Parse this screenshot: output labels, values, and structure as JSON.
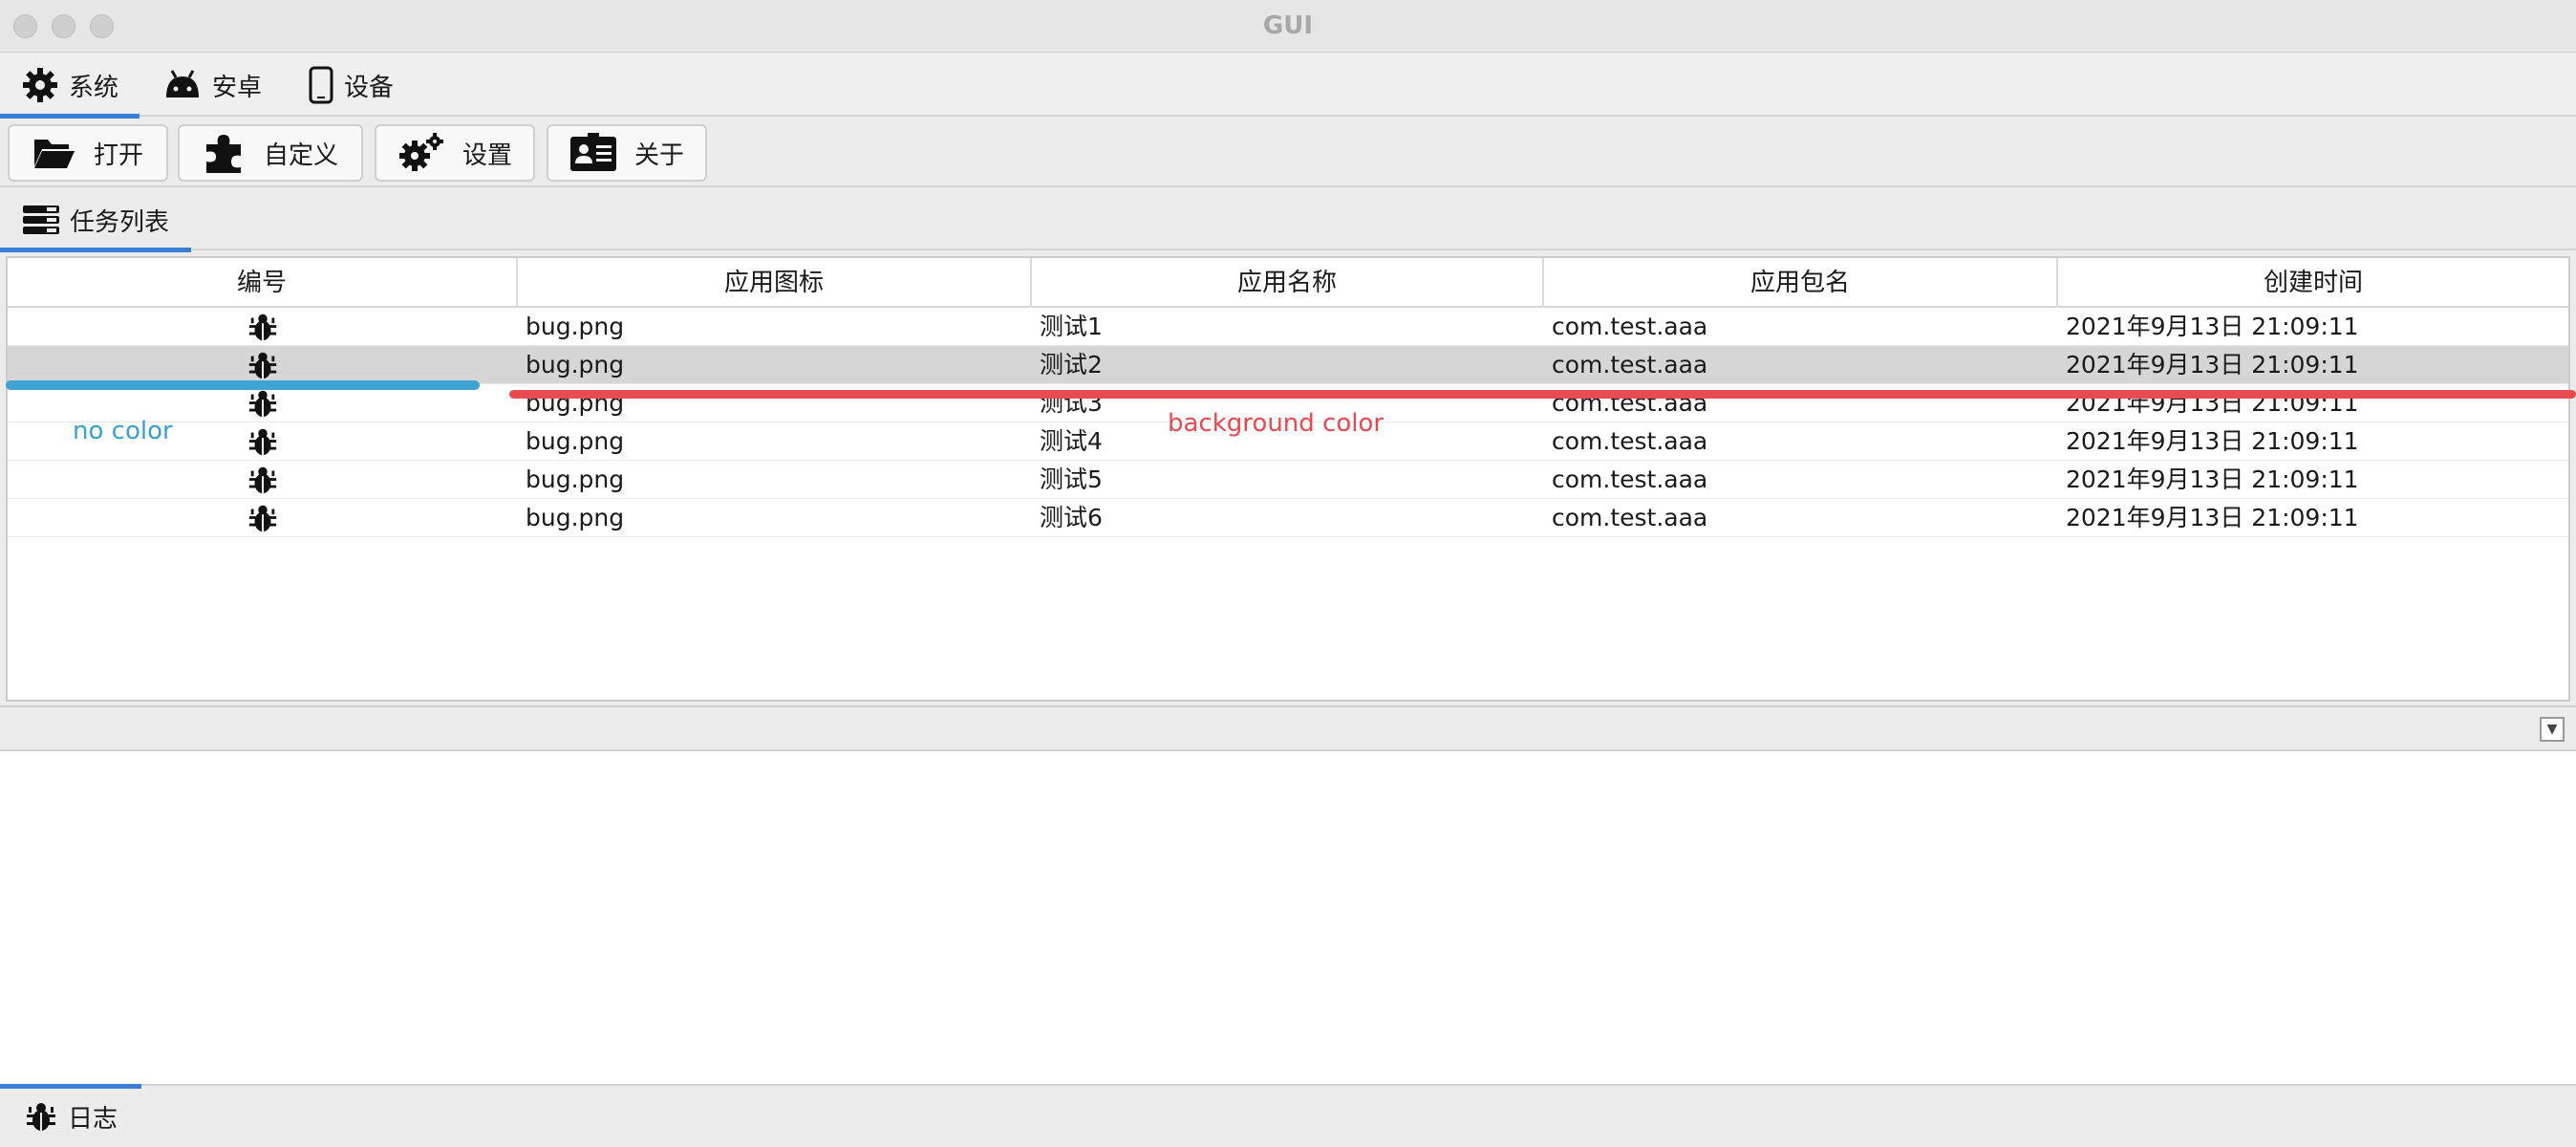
{
  "window": {
    "title": "GUI"
  },
  "tabs": [
    {
      "label": "系统",
      "icon": "gear-icon",
      "active": true
    },
    {
      "label": "安卓",
      "icon": "android-icon",
      "active": false
    },
    {
      "label": "设备",
      "icon": "phone-icon",
      "active": false
    }
  ],
  "toolbar": {
    "open_label": "打开",
    "custom_label": "自定义",
    "settings_label": "设置",
    "about_label": "关于"
  },
  "section": {
    "label": "任务列表",
    "icon": "list-icon"
  },
  "table": {
    "columns": [
      "编号",
      "应用图标",
      "应用名称",
      "应用包名",
      "创建时间"
    ],
    "rows": [
      {
        "icon": "bug-icon",
        "file": "bug.png",
        "name": "测试1",
        "package": "com.test.aaa",
        "time": "2021年9月13日 21:09:11"
      },
      {
        "icon": "bug-icon",
        "file": "bug.png",
        "name": "测试2",
        "package": "com.test.aaa",
        "time": "2021年9月13日 21:09:11"
      },
      {
        "icon": "bug-icon",
        "file": "bug.png",
        "name": "测试3",
        "package": "com.test.aaa",
        "time": "2021年9月13日 21:09:11"
      },
      {
        "icon": "bug-icon",
        "file": "bug.png",
        "name": "测试4",
        "package": "com.test.aaa",
        "time": "2021年9月13日 21:09:11"
      },
      {
        "icon": "bug-icon",
        "file": "bug.png",
        "name": "测试5",
        "package": "com.test.aaa",
        "time": "2021年9月13日 21:09:11"
      },
      {
        "icon": "bug-icon",
        "file": "bug.png",
        "name": "测试6",
        "package": "com.test.aaa",
        "time": "2021年9月13日 21:09:11"
      }
    ],
    "selected_row": 2
  },
  "annotations": {
    "left_label": "no color",
    "right_label": "background color",
    "left_color": "#3fa3d4",
    "right_color": "#e84a50"
  },
  "log_tab": {
    "label": "日志",
    "icon": "bug-icon"
  },
  "colors": {
    "accent": "#3a7fd5",
    "selected_row_bg": "#d6d6d6"
  }
}
